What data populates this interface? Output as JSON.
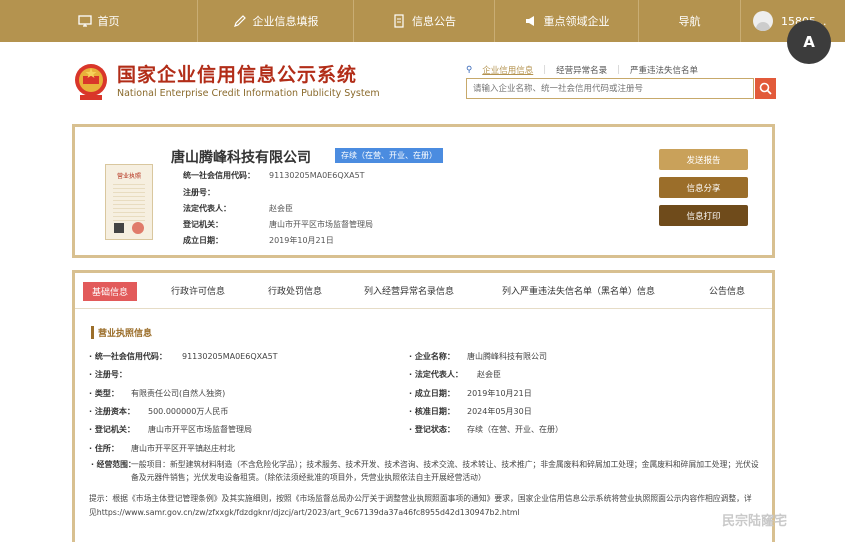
{
  "nav": {
    "items": [
      {
        "label": "首页",
        "icon": "monitor-icon"
      },
      {
        "label": "企业信息填报",
        "icon": "edit-icon"
      },
      {
        "label": "信息公告",
        "icon": "document-icon"
      },
      {
        "label": "重点领域企业",
        "icon": "megaphone-icon"
      },
      {
        "label": "导航",
        "icon": ""
      }
    ],
    "user": "15805..."
  },
  "overlay_button": "A",
  "logo": {
    "title_cn": "国家企业信用信息公示系统",
    "title_en": "National Enterprise Credit Information Publicity System"
  },
  "search": {
    "tabs": [
      "企业信用信息",
      "经营异常名录",
      "严重违法失信名单"
    ],
    "placeholder": "请输入企业名称、统一社会信用代码或注册号"
  },
  "summary": {
    "license_title": "营业执照",
    "company_name": "唐山腾峰科技有限公司",
    "status": "存续（在营、开业、在册）",
    "fields": [
      {
        "label": "统一社会信用代码：",
        "value": "91130205MA0E6QXA5T"
      },
      {
        "label": "注册号：",
        "value": ""
      },
      {
        "label": "法定代表人：",
        "value": "赵会臣"
      },
      {
        "label": "登记机关：",
        "value": "唐山市开平区市场监督管理局"
      },
      {
        "label": "成立日期：",
        "value": "2019年10月21日"
      }
    ],
    "actions": [
      "发送报告",
      "信息分享",
      "信息打印"
    ]
  },
  "detail": {
    "tabs": [
      "基础信息",
      "行政许可信息",
      "行政处罚信息",
      "列入经营异常名录信息",
      "列入严重违法失信名单（黑名单）信息",
      "公告信息"
    ],
    "section_title": "营业执照信息",
    "left_fields": [
      {
        "label": "· 统一社会信用代码：",
        "value": "91130205MA0E6QXA5T"
      },
      {
        "label": "· 注册号：",
        "value": ""
      },
      {
        "label": "· 类型：",
        "value": "有限责任公司(自然人独资)"
      },
      {
        "label": "· 注册资本：",
        "value": "500.000000万人民币"
      },
      {
        "label": "· 登记机关：",
        "value": "唐山市开平区市场监督管理局"
      },
      {
        "label": "· 住所：",
        "value": "唐山市开平区开平镇赵庄村北"
      }
    ],
    "right_fields": [
      {
        "label": "· 企业名称：",
        "value": "唐山腾峰科技有限公司"
      },
      {
        "label": "· 法定代表人：",
        "value": "赵会臣"
      },
      {
        "label": "· 成立日期：",
        "value": "2019年10月21日"
      },
      {
        "label": "· 核准日期：",
        "value": "2024年05月30日"
      },
      {
        "label": "· 登记状态：",
        "value": "存续（在营、开业、在册）"
      }
    ],
    "scope_label": "· 经营范围：",
    "scope_value": "一般项目：新型建筑材料制造（不含危险化学品）；技术服务、技术开发、技术咨询、技术交流、技术转让、技术推广；非金属废料和碎屑加工处理；金属废料和碎屑加工处理；光伏设备及元器件销售；光伏发电设备租赁。（除依法须经批准的项目外，凭营业执照依法自主开展经营活动）",
    "notice": "提示：根据《市场主体登记管理条例》及其实施细则，按照《市场监督总局办公厅关于调整营业执照照面事项的通知》要求，国家企业信用信息公示系统将营业执照照面公示内容作相应调整，详见https://www.samr.gov.cn/zw/zfxxgk/fdzdgknr/djzcj/art/2023/art_9c67139da37a46fc8955d42d130947b2.html"
  },
  "watermark": "民宗陆窿宅"
}
